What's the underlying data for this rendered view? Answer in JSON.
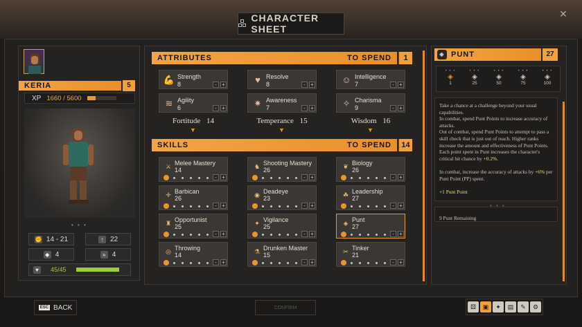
{
  "header": {
    "title": "CHARACTER SHEET",
    "close_glyph": "✕"
  },
  "character": {
    "name": "KERIA",
    "level": "5",
    "xp_label": "XP",
    "xp_value": "1660 / 5600",
    "xp_progress": 0.3,
    "stats": {
      "damage": "14 - 21",
      "attack": "22",
      "armor": "4",
      "speed": "4",
      "health": "45/45",
      "health_progress": 1.0
    }
  },
  "attributes": {
    "header": "ATTRIBUTES",
    "to_spend_label": "TO SPEND",
    "to_spend": "1",
    "groups": [
      {
        "name": "Fortitude",
        "value": "14",
        "items": [
          {
            "name": "Strength",
            "value": "8",
            "icon": "arm-icon"
          },
          {
            "name": "Agility",
            "value": "6",
            "icon": "wing-icon"
          }
        ]
      },
      {
        "name": "Temperance",
        "value": "15",
        "items": [
          {
            "name": "Resolve",
            "value": "8",
            "icon": "heart-icon"
          },
          {
            "name": "Awareness",
            "value": "7",
            "icon": "sun-icon"
          }
        ]
      },
      {
        "name": "Wisdom",
        "value": "16",
        "items": [
          {
            "name": "Intelligence",
            "value": "7",
            "icon": "head-icon"
          },
          {
            "name": "Charisma",
            "value": "9",
            "icon": "sparkle-icon"
          }
        ]
      }
    ]
  },
  "skills": {
    "header": "SKILLS",
    "to_spend_label": "TO SPEND",
    "to_spend": "14",
    "columns": [
      [
        {
          "name": "Melee Mastery",
          "value": "14"
        },
        {
          "name": "Barbican",
          "value": "26"
        },
        {
          "name": "Opportunist",
          "value": "25"
        },
        {
          "name": "Throwing",
          "value": "14"
        }
      ],
      [
        {
          "name": "Shooting Mastery",
          "value": "26"
        },
        {
          "name": "Deadeye",
          "value": "23"
        },
        {
          "name": "Vigilance",
          "value": "25"
        },
        {
          "name": "Drunken Master",
          "value": "15"
        }
      ],
      [
        {
          "name": "Biology",
          "value": "26"
        },
        {
          "name": "Leadership",
          "value": "27"
        },
        {
          "name": "Punt",
          "value": "27"
        },
        {
          "name": "Tinker",
          "value": "21"
        }
      ]
    ]
  },
  "detail": {
    "title": "PUNT",
    "value": "27",
    "ranks": [
      "1",
      "25",
      "50",
      "75",
      "100"
    ],
    "desc_1": "Take a chance at a challenge beyond your usual capabilities.",
    "desc_2": "In combat, spend Punt Points to increase accuracy of attacks.",
    "desc_3": "Out of combat, spend Punt Points to attempt to pass a skill check that is just out of reach. Higher ranks increase the amount and effectiveness of Punt Points. Each point spent in Punt increases the character's critical hit chance by",
    "desc_3_hl": "+0.2%",
    "desc_4": "In combat, increase the accuracy of attacks by",
    "desc_4_hl": "+6%",
    "desc_4_tail": "per Punt Point (PP) spent.",
    "bonus": "+1 Punt Point",
    "remaining": "9 Punt Remaining"
  },
  "footer": {
    "back_key": "ESC",
    "back_label": "BACK",
    "confirm_label": "CONFIRM"
  },
  "colors": {
    "accent": "#f0a03c",
    "highlight": "#d7e27a",
    "health": "#9bcf3a"
  }
}
